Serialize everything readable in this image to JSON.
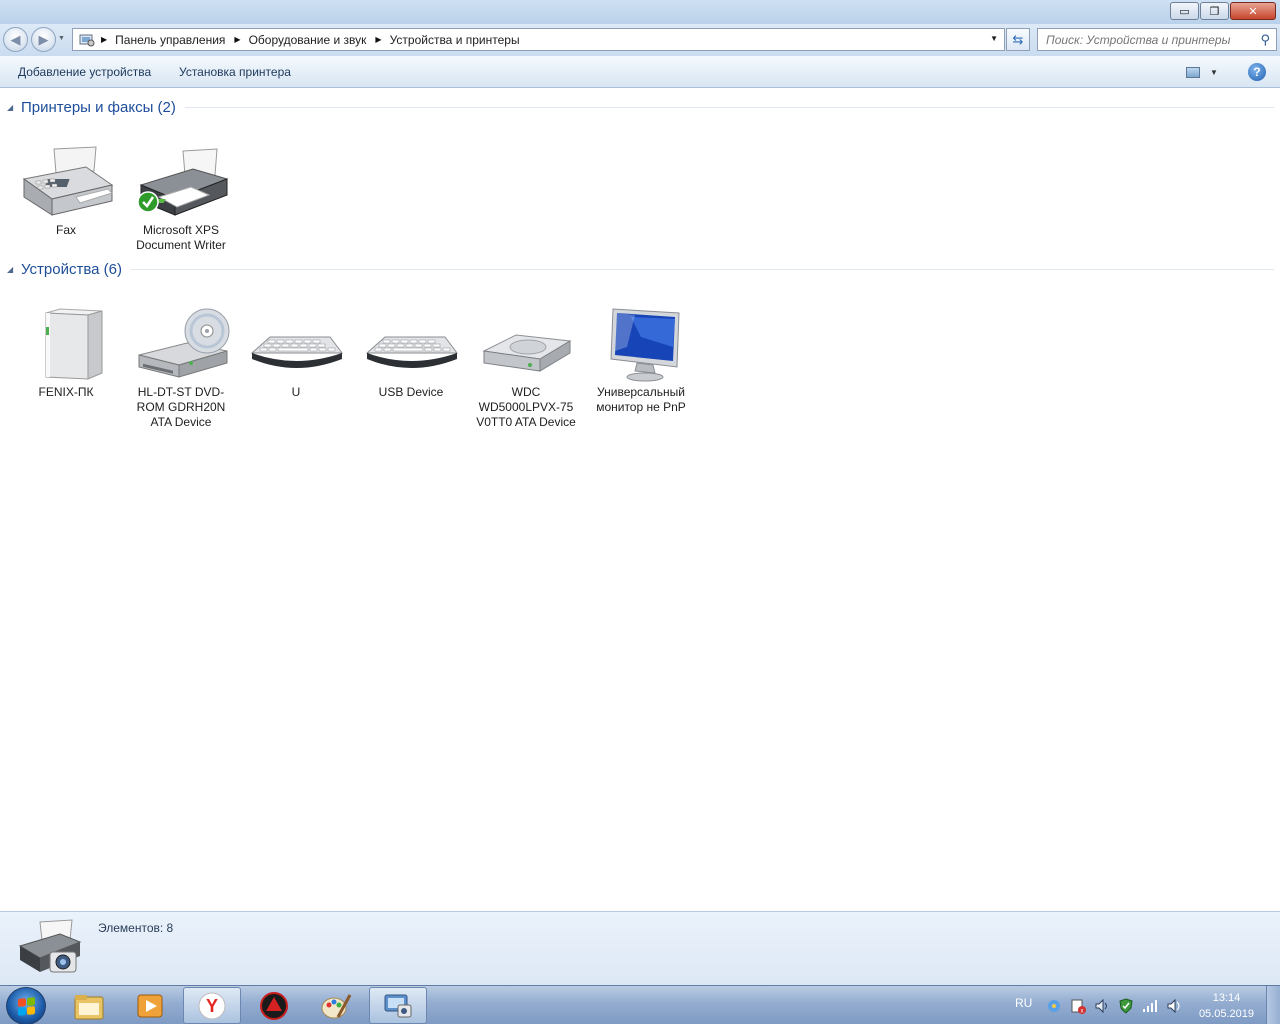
{
  "window": {
    "controls": {
      "minimize": "▭",
      "restore": "❐",
      "close": "✕"
    }
  },
  "nav": {
    "back_icon": "back-arrow-icon",
    "forward_icon": "forward-arrow-icon",
    "breadcrumbs": [
      "Панель управления",
      "Оборудование и звук",
      "Устройства и принтеры"
    ],
    "search_placeholder": "Поиск: Устройства и принтеры"
  },
  "commands": {
    "add_device": "Добавление устройства",
    "add_printer": "Установка принтера",
    "help": "?"
  },
  "groups": [
    {
      "title": "Принтеры и факсы (2)",
      "items": [
        {
          "label": "Fax",
          "icon": "fax-icon"
        },
        {
          "label": "Microsoft XPS Document Writer",
          "icon": "printer-icon",
          "default": true
        }
      ]
    },
    {
      "title": "Устройства (6)",
      "items": [
        {
          "label": "FENIX-ПК",
          "icon": "computer-tower-icon"
        },
        {
          "label": "HL-DT-ST DVD-ROM GDRH20N ATA Device",
          "icon": "dvd-drive-icon"
        },
        {
          "label": "U",
          "icon": "keyboard-icon"
        },
        {
          "label": "USB Device",
          "icon": "keyboard-icon"
        },
        {
          "label": "WDC WD5000LPVX-75 V0TT0 ATA Device",
          "icon": "hard-drive-icon"
        },
        {
          "label": "Универсальный монитор не PnP",
          "icon": "monitor-icon"
        }
      ]
    }
  ],
  "details": {
    "count_text": "Элементов: 8"
  },
  "taskbar": {
    "items": [
      {
        "name": "explorer-icon",
        "active": false
      },
      {
        "name": "media-player-icon",
        "active": false
      },
      {
        "name": "yandex-browser-icon",
        "active": true
      },
      {
        "name": "game-app-icon",
        "active": false
      },
      {
        "name": "paint-icon",
        "active": false
      },
      {
        "name": "devices-printers-icon",
        "active": true
      }
    ],
    "language": "RU",
    "time": "13:14",
    "date": "05.05.2019"
  }
}
